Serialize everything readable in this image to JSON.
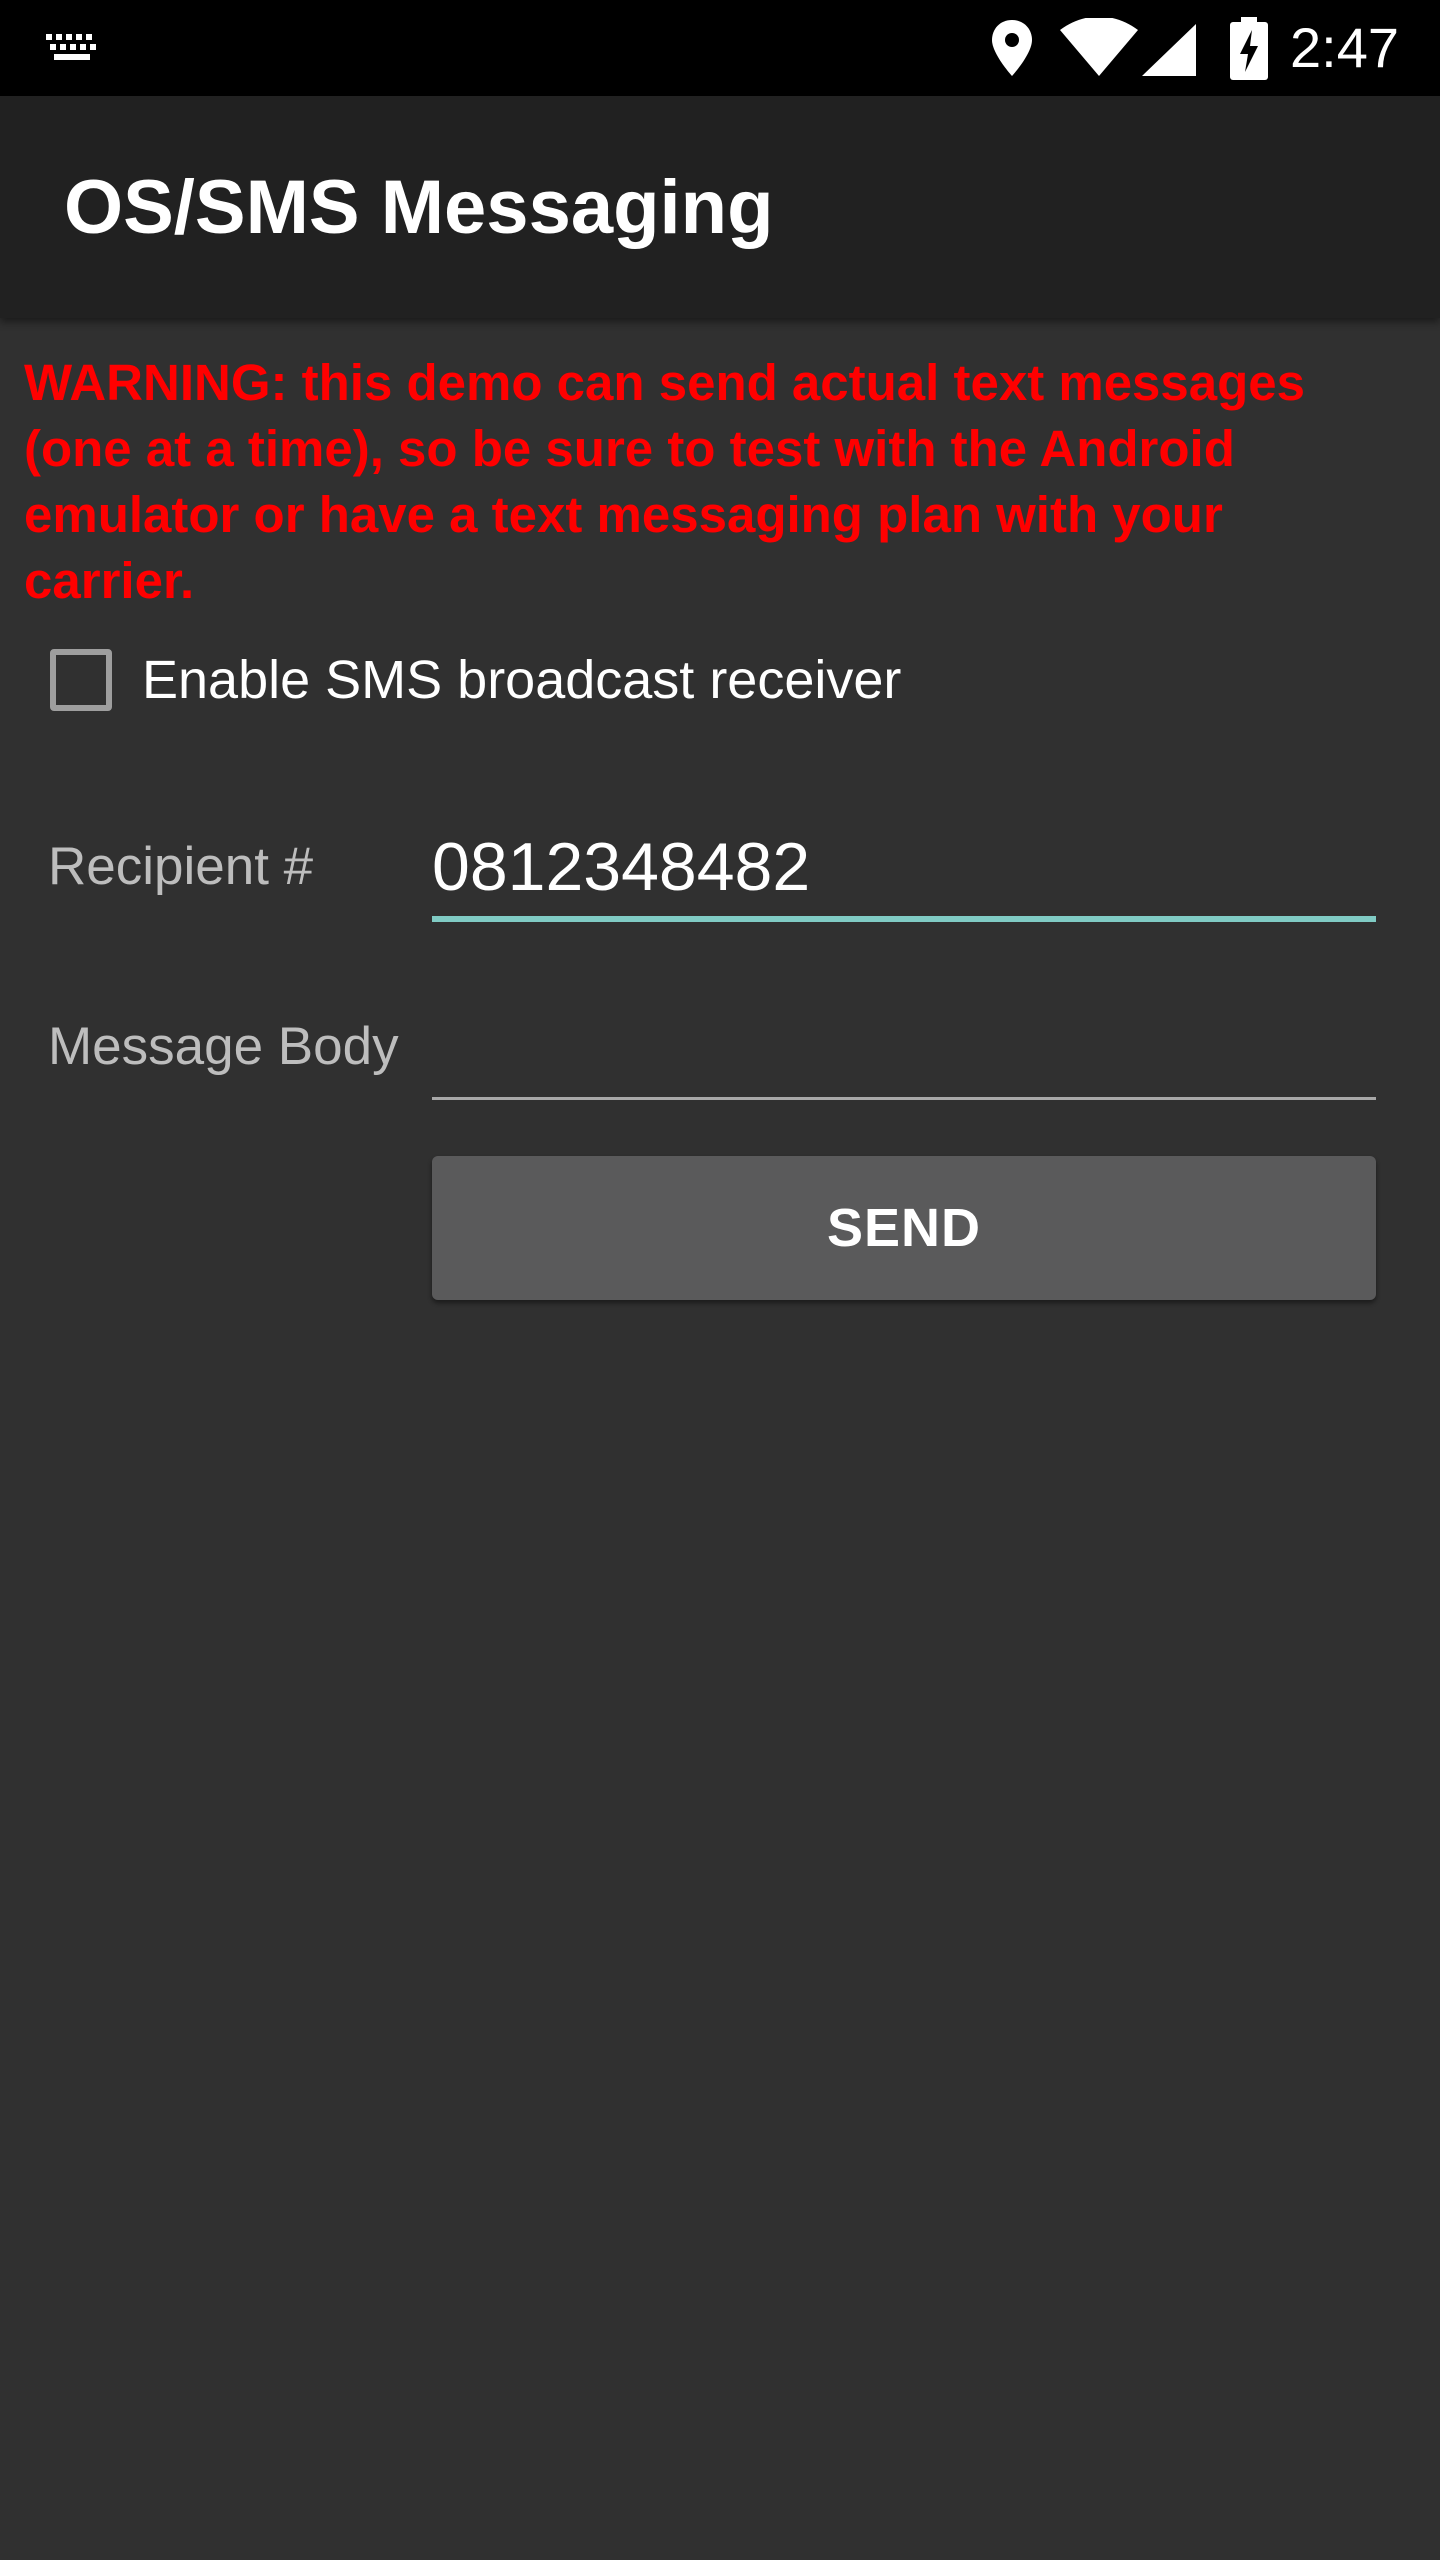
{
  "status_bar": {
    "time": "2:47",
    "icons": [
      "keyboard-icon",
      "location-icon",
      "wifi-icon",
      "signal-icon",
      "battery-charging-icon"
    ]
  },
  "app_bar": {
    "title": "OS/SMS Messaging"
  },
  "warning": {
    "text": "WARNING: this demo can send actual text messages (one at a time), so be sure to test with the Android emulator or have a text messaging plan with your carrier."
  },
  "sms_receiver": {
    "label": "Enable SMS broadcast receiver",
    "checked": false
  },
  "form": {
    "recipient_label": "Recipient #",
    "recipient_value": "0812348482",
    "body_label": "Message Body",
    "body_value": "",
    "send_label": "SEND"
  },
  "colors": {
    "warning": "#ff0000",
    "accent": "#80cbc4",
    "background": "#303030",
    "app_bar": "#212121",
    "button": "#5a5a5b"
  }
}
